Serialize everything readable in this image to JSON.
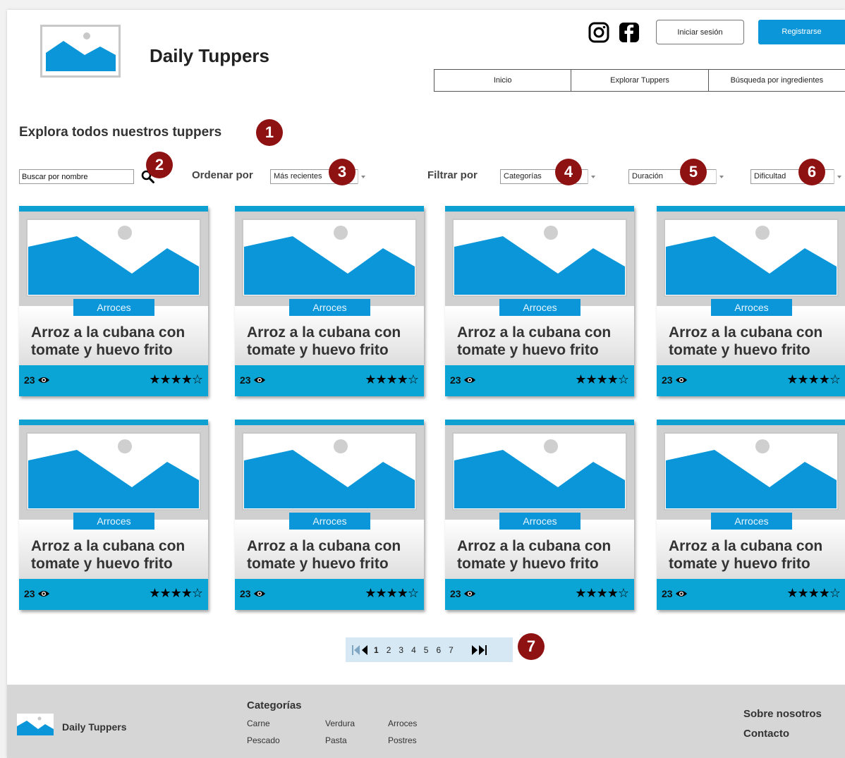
{
  "header": {
    "site_title": "Daily Tuppers",
    "login_label": "Iniciar sesión",
    "register_label": "Registrarse",
    "nav": [
      "Inicio",
      "Explorar Tuppers",
      "Búsqueda por ingredientes"
    ]
  },
  "main": {
    "heading": "Explora todos nuestros tuppers",
    "search_placeholder": "Buscar por nombre",
    "sort_label": "Ordenar por",
    "sort_value": "Más recientes",
    "filter_label": "Filtrar por",
    "filters": [
      "Categorías",
      "Duración",
      "Dificultad"
    ]
  },
  "badges": [
    "1",
    "2",
    "3",
    "4",
    "5",
    "6",
    "7"
  ],
  "cards": [
    {
      "category": "Arroces",
      "title": "Arroz a la cubana con tomate y huevo frito",
      "views": "23",
      "stars": "★★★★☆"
    },
    {
      "category": "Arroces",
      "title": "Arroz a la cubana con tomate y huevo frito",
      "views": "23",
      "stars": "★★★★☆"
    },
    {
      "category": "Arroces",
      "title": "Arroz a la cubana con tomate y huevo frito",
      "views": "23",
      "stars": "★★★★☆"
    },
    {
      "category": "Arroces",
      "title": "Arroz a la cubana con tomate y huevo frito",
      "views": "23",
      "stars": "★★★★☆"
    },
    {
      "category": "Arroces",
      "title": "Arroz a la cubana con tomate y huevo frito",
      "views": "23",
      "stars": "★★★★☆"
    },
    {
      "category": "Arroces",
      "title": "Arroz a la cubana con tomate y huevo frito",
      "views": "23",
      "stars": "★★★★☆"
    },
    {
      "category": "Arroces",
      "title": "Arroz a la cubana con tomate y huevo frito",
      "views": "23",
      "stars": "★★★★☆"
    },
    {
      "category": "Arroces",
      "title": "Arroz a la cubana con tomate y huevo frito",
      "views": "23",
      "stars": "★★★★☆"
    }
  ],
  "pagination": {
    "pages": [
      "1",
      "2",
      "3",
      "4",
      "5",
      "6",
      "7"
    ],
    "current": "1"
  },
  "footer": {
    "brand": "Daily Tuppers",
    "categories_title": "Categorías",
    "categories": [
      "Carne",
      "Verdura",
      "Arroces",
      "Pescado",
      "Pasta",
      "Postres"
    ],
    "about": "Sobre nosotros",
    "contact": "Contacto"
  },
  "colors": {
    "accent": "#0a96d8",
    "badge": "#8e1212",
    "card_bar": "#0aa5d5"
  },
  "icons": [
    "image-placeholder-icon",
    "instagram-icon",
    "facebook-icon",
    "search-icon",
    "eye-icon",
    "star-icon",
    "first-page-icon",
    "prev-page-icon",
    "next-page-icon",
    "last-page-icon"
  ]
}
